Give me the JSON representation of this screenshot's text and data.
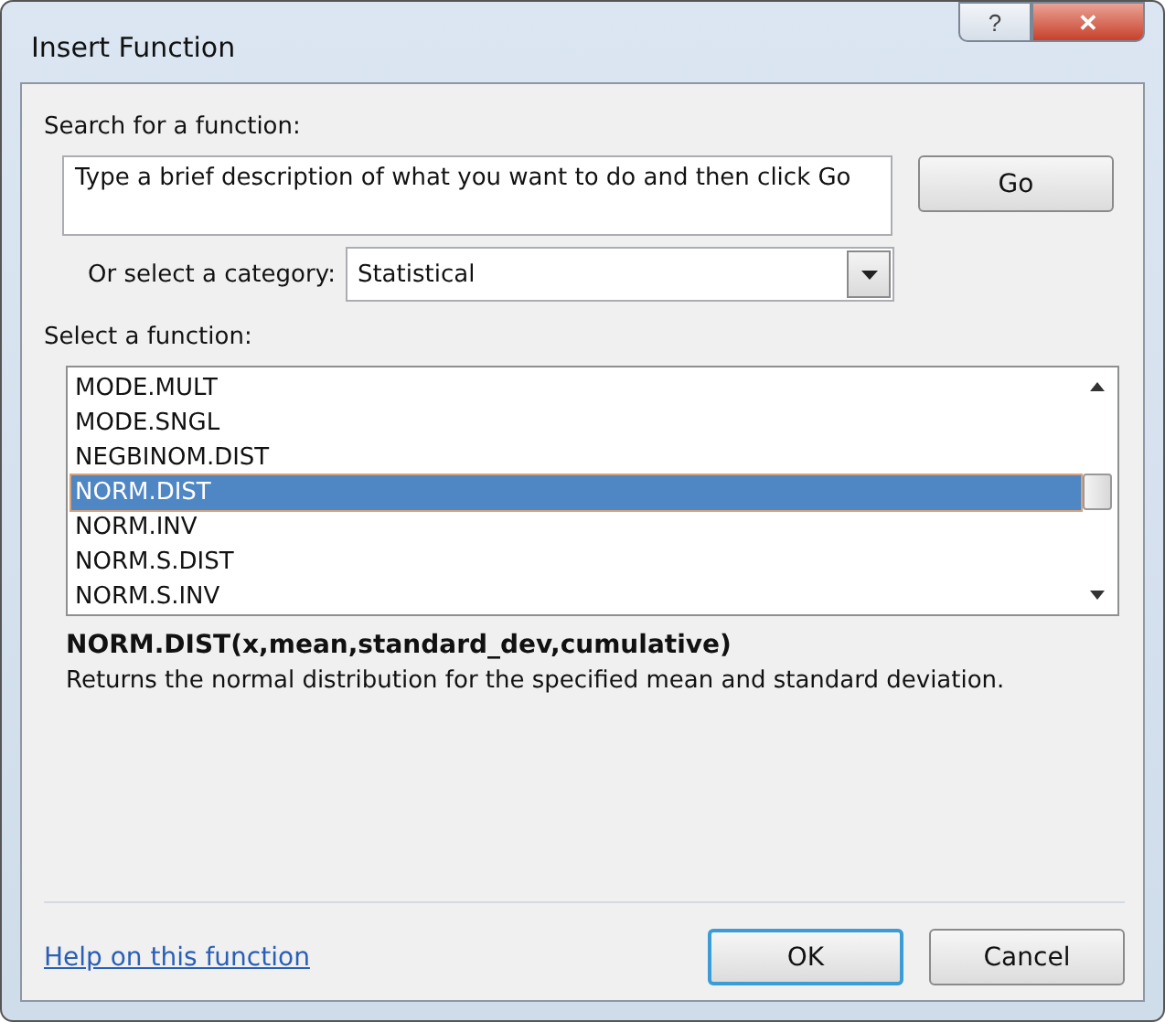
{
  "window": {
    "title": "Insert Function",
    "buttons": [
      "?",
      "✕"
    ]
  },
  "search": {
    "label": "Search for a function:",
    "value": "Type a brief description of what you want to do and then click Go",
    "button": "Go"
  },
  "category": {
    "label": "Or select a category:",
    "value": "Statistical"
  },
  "functions": {
    "label": "Select a function:",
    "items": [
      {
        "name": "MODE.MULT",
        "selected": false
      },
      {
        "name": "MODE.SNGL",
        "selected": false
      },
      {
        "name": "NEGBINOM.DIST",
        "selected": false
      },
      {
        "name": "NORM.DIST",
        "selected": true
      },
      {
        "name": "NORM.INV",
        "selected": false
      },
      {
        "name": "NORM.S.DIST",
        "selected": false
      },
      {
        "name": "NORM.S.INV",
        "selected": false
      }
    ]
  },
  "signature": "NORM.DIST(x,mean,standard_dev,cumulative)",
  "description": "Returns the normal distribution for the specified mean and standard deviation.",
  "help_link": "Help on this function",
  "buttons": [
    {
      "label": "OK",
      "kind": "default"
    },
    {
      "label": "Cancel",
      "kind": "normal"
    }
  ]
}
